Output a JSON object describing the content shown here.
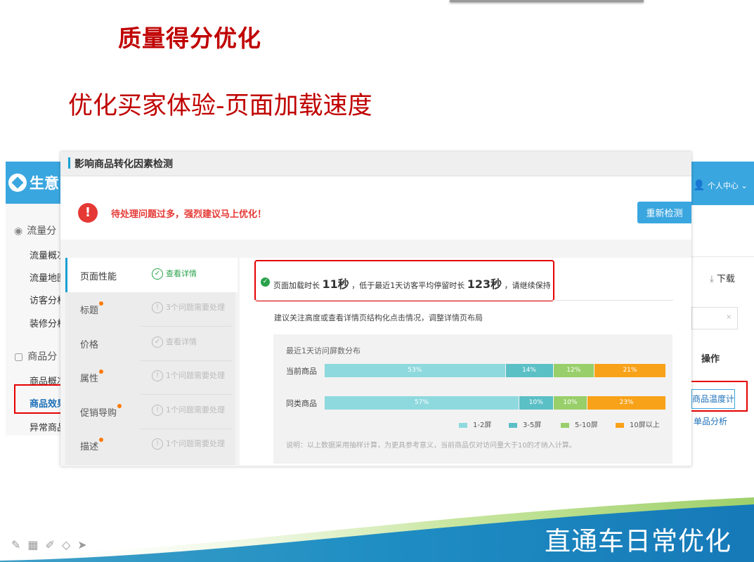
{
  "slide": {
    "title": "质量得分优化",
    "subtitle": "优化买家体验-页面加载速度",
    "footer": "直通车日常优化"
  },
  "background_app": {
    "brand": "生意",
    "sidebar": [
      {
        "label": "流量分",
        "type": "section",
        "icon": "eye-icon"
      },
      {
        "label": "流量概况",
        "type": "item"
      },
      {
        "label": "流量地图",
        "type": "item"
      },
      {
        "label": "访客分析",
        "type": "item"
      },
      {
        "label": "装修分析",
        "type": "item"
      },
      {
        "label": "商品分",
        "type": "section",
        "icon": "box-icon"
      },
      {
        "label": "商品概况",
        "type": "item"
      },
      {
        "label": "商品效果",
        "type": "item",
        "active": true
      },
      {
        "label": "异常商品",
        "type": "item"
      }
    ],
    "user_center": "个人中心",
    "download": "下载",
    "column_op": "操作",
    "temp_button": "商品温度计",
    "single_analysis": "单品分析"
  },
  "panel": {
    "title": "影响商品转化因素检测",
    "alert": "待处理问题过多，强烈建议马上优化！",
    "retest_button": "重新检测",
    "rows": [
      {
        "name": "页面性能",
        "status": "查看详情",
        "state": "ok",
        "active": true,
        "dot": false
      },
      {
        "name": "标题",
        "status": "3个问题需要处理",
        "state": "warn",
        "dot": true
      },
      {
        "name": "价格",
        "status": "查看详情",
        "state": "ok-muted",
        "dot": false
      },
      {
        "name": "属性",
        "status": "1个问题需要处理",
        "state": "warn",
        "dot": true
      },
      {
        "name": "促销导购",
        "status": "1个问题需要处理",
        "state": "warn",
        "dot": true
      },
      {
        "name": "描述",
        "status": "1个问题需要处理",
        "state": "warn",
        "dot": true
      }
    ],
    "result": {
      "prefix": "页面加载时长",
      "load_time": "11秒",
      "middle": "，低于最近1天访客平均停留时长",
      "stay_time": "123秒",
      "suffix": "，请继续保持"
    },
    "advice": "建议关注高度或查看详情页结构化点击情况，调整详情页布局",
    "note": "说明：以上数据采用抽样计算，为更具参考意义，当前商品仅对访问量大于10的才纳入计算。"
  },
  "chart_data": {
    "type": "bar",
    "orientation": "horizontal-stacked",
    "title": "最近1天访问屏数分布",
    "categories": [
      "当前商品",
      "同类商品"
    ],
    "series": [
      {
        "name": "1-2屏",
        "values": [
          53,
          57
        ],
        "color": "#8ed9de"
      },
      {
        "name": "3-5屏",
        "values": [
          14,
          10
        ],
        "color": "#5bbfc6"
      },
      {
        "name": "5-10屏",
        "values": [
          12,
          10
        ],
        "color": "#98cf6a"
      },
      {
        "name": "10屏以上",
        "values": [
          21,
          23
        ],
        "color": "#f8a21a"
      }
    ],
    "unit": "%"
  }
}
